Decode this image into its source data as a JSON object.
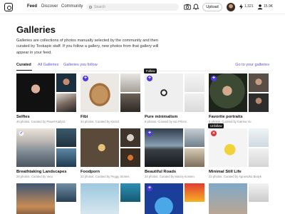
{
  "nav": {
    "items": [
      "Feed",
      "Discover",
      "Community"
    ],
    "search_placeholder": "Search",
    "upload_label": "Upload",
    "likes_count": "1,321",
    "followers_count": "15.9K"
  },
  "page": {
    "title": "Galleries",
    "description": "Galleries are collections of photos manually selected by the community and then curated by Tookapic staff. If you follow a gallery, new photos from that gallery will appear in your feed."
  },
  "tabs": {
    "items": [
      "Curated",
      "All Galleries",
      "Galleries you follow"
    ],
    "right_link": "Go to your galleries"
  },
  "tooltips": {
    "follow": "Follow",
    "unfollow": "Unfollow"
  },
  "galleries": [
    {
      "title": "Selfies",
      "meta": "45 photos. Curated by Paweł Kadysz"
    },
    {
      "title": "Fibi",
      "meta": "34 photos. Curated by Kaziol"
    },
    {
      "title": "Pure minimalism",
      "meta": "8 photos. Curated by Ian Prince"
    },
    {
      "title": "Favorite portraits",
      "meta": "8 photos. Curated by Katrina Vu"
    },
    {
      "title": "Breathtaking Landscapes",
      "meta": "28 photos. Curated by Vera"
    },
    {
      "title": "Foodporn",
      "meta": "22 photos. Curated by Peggy Stories"
    },
    {
      "title": "Beautiful Roads",
      "meta": "34 photos. Curated by Maciej Konsen"
    },
    {
      "title": "Minimal Still Life",
      "meta": "22 photos. Curated by Agnieszka Bialyk"
    }
  ]
}
